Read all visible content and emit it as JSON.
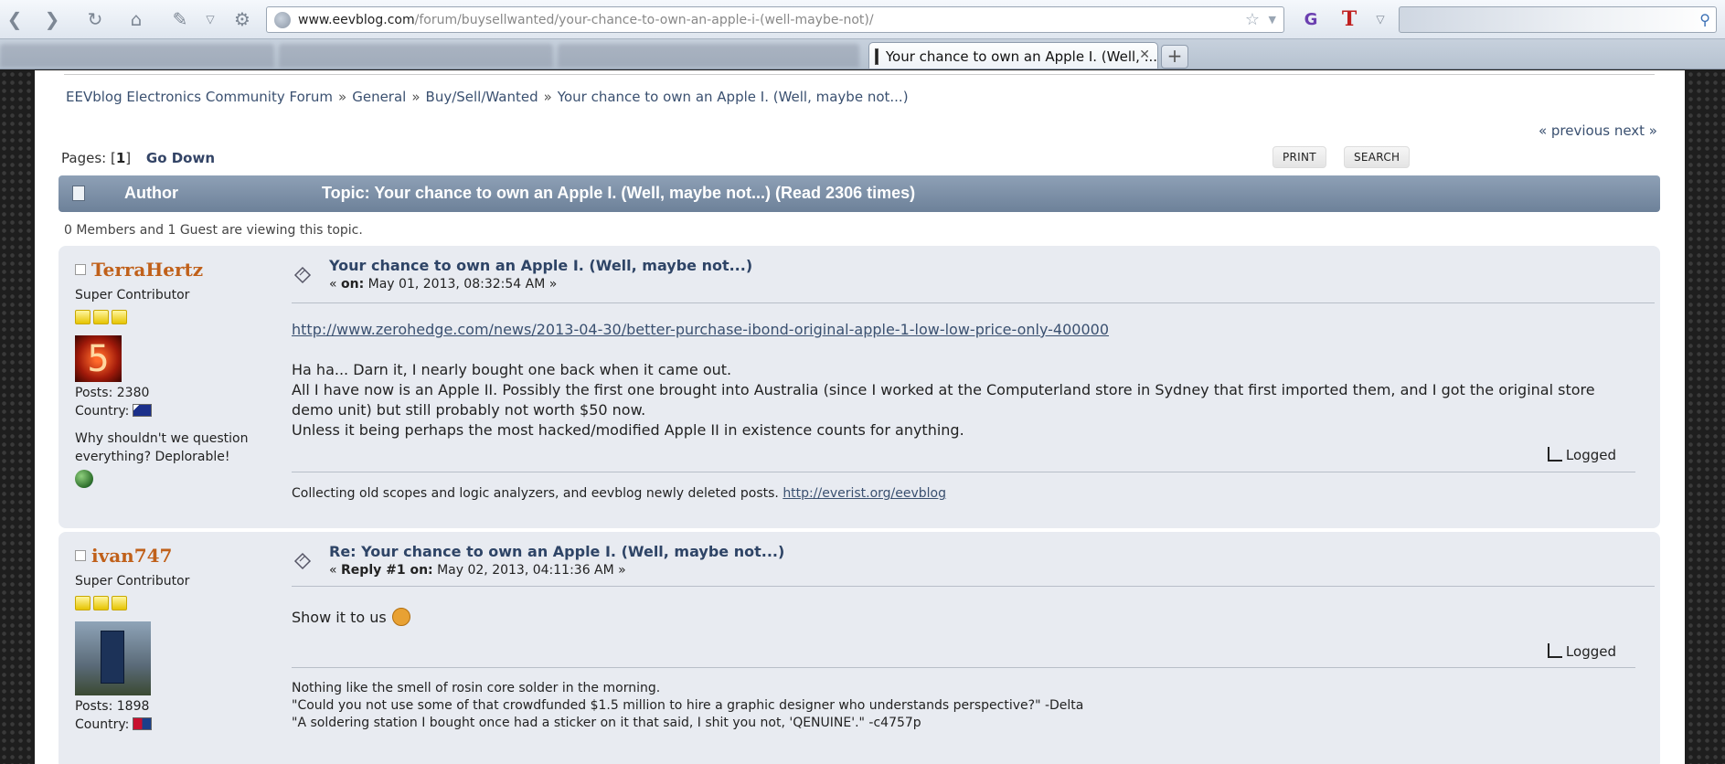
{
  "browser": {
    "url_domain": "www.eevblog.com",
    "url_path": "/forum/buysellwanted/your-chance-to-own-an-apple-i-(well-maybe-not)/",
    "tab_title": "Your chance to own an Apple I. (Well, ...",
    "new_tab": "+",
    "tab_close": "✕"
  },
  "breadcrumb": {
    "items": [
      "EEVblog Electronics Community Forum",
      "General",
      "Buy/Sell/Wanted",
      "Your chance to own an Apple I. (Well, maybe not...)"
    ],
    "separator": "»"
  },
  "nav": {
    "prev": "« previous",
    "next": "next »",
    "pages_label": "Pages: [",
    "page_current": "1",
    "pages_close": "]",
    "go_down": "Go Down",
    "print": "PRINT",
    "search": "SEARCH"
  },
  "header": {
    "author": "Author",
    "topic": "Topic: Your chance to own an Apple I. (Well, maybe not...)  (Read 2306 times)"
  },
  "viewing": "0 Members and 1 Guest are viewing this topic.",
  "posts": [
    {
      "author": "TerraHertz",
      "rank": "Super Contributor",
      "posts": "Posts: 2380",
      "country": "Country:",
      "blurb": "Why shouldn't we question everything? Deplorable!",
      "avatar_text": "5",
      "subject": "Your chance to own an Apple I. (Well, maybe not...)",
      "date_prefix": "« ",
      "date_label": "on:",
      "date": " May 01, 2013, 08:32:54 AM »",
      "link": "http://www.zerohedge.com/news/2013-04-30/better-purchase-ibond-original-apple-1-low-low-price-only-400000",
      "body": [
        "Ha ha... Darn it, I nearly bought one back when it came out.",
        "All I have now is an Apple II. Possibly the first one brought into Australia (since I worked at the Computerland store in Sydney that first imported them, and I got the original store",
        "demo unit) but still probably not worth $50 now.",
        "Unless it being perhaps the most hacked/modified Apple II in existence counts for anything."
      ],
      "logged": "Logged",
      "signature": "Collecting old scopes and logic analyzers, and eevblog newly deleted posts. ",
      "signature_link": "http://everist.org/eevblog"
    },
    {
      "author": "ivan747",
      "rank": "Super Contributor",
      "posts": "Posts: 1898",
      "country": "Country:",
      "subject": "Re: Your chance to own an Apple I. (Well, maybe not...)",
      "date_prefix": "« ",
      "date_label": "Reply #1 on:",
      "date": " May 02, 2013, 04:11:36 AM »",
      "body": "Show it to us",
      "logged": "Logged",
      "signature": [
        "Nothing like the smell of rosin core solder in the morning.",
        "\"Could you not use some of that crowdfunded $1.5 million to hire a graphic designer who understands perspective?\" -Delta",
        "\"A soldering station I bought once had a sticker on it that said, I shit you not, 'QENUINE'.\" -c4757p"
      ]
    }
  ]
}
